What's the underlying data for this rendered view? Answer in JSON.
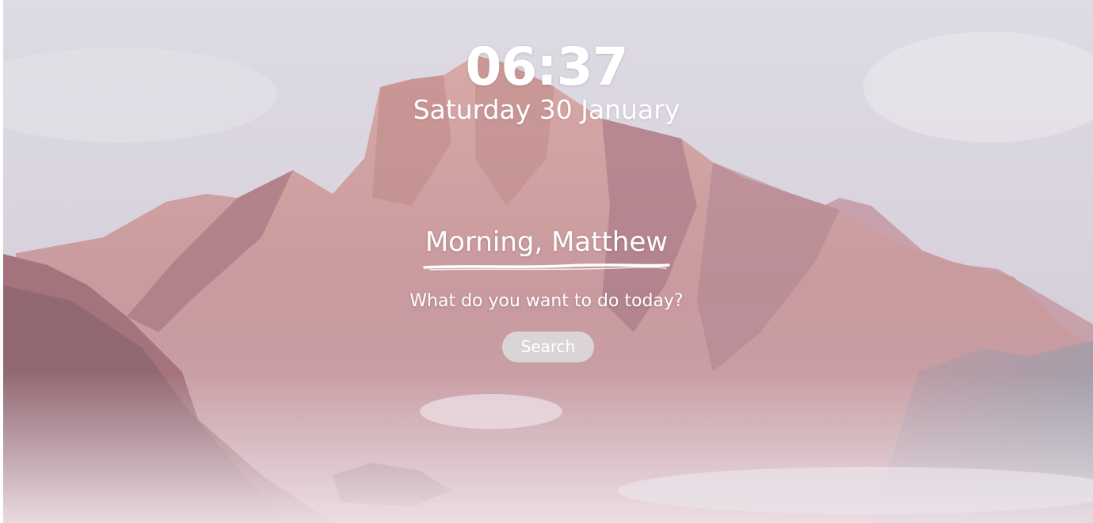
{
  "clock": {
    "time": "06:37"
  },
  "date": {
    "text": "Saturday 30 January"
  },
  "greeting": {
    "text": "Morning, Matthew"
  },
  "prompt": {
    "question": "What do you want to do today?"
  },
  "search": {
    "button_label": "Search"
  },
  "colors": {
    "text": "#ffffff",
    "button_bg": "#dcdcde",
    "sky": "#d9d6e0",
    "mountain": "#c99a9e",
    "mountain_shadow": "#9c6e78"
  }
}
